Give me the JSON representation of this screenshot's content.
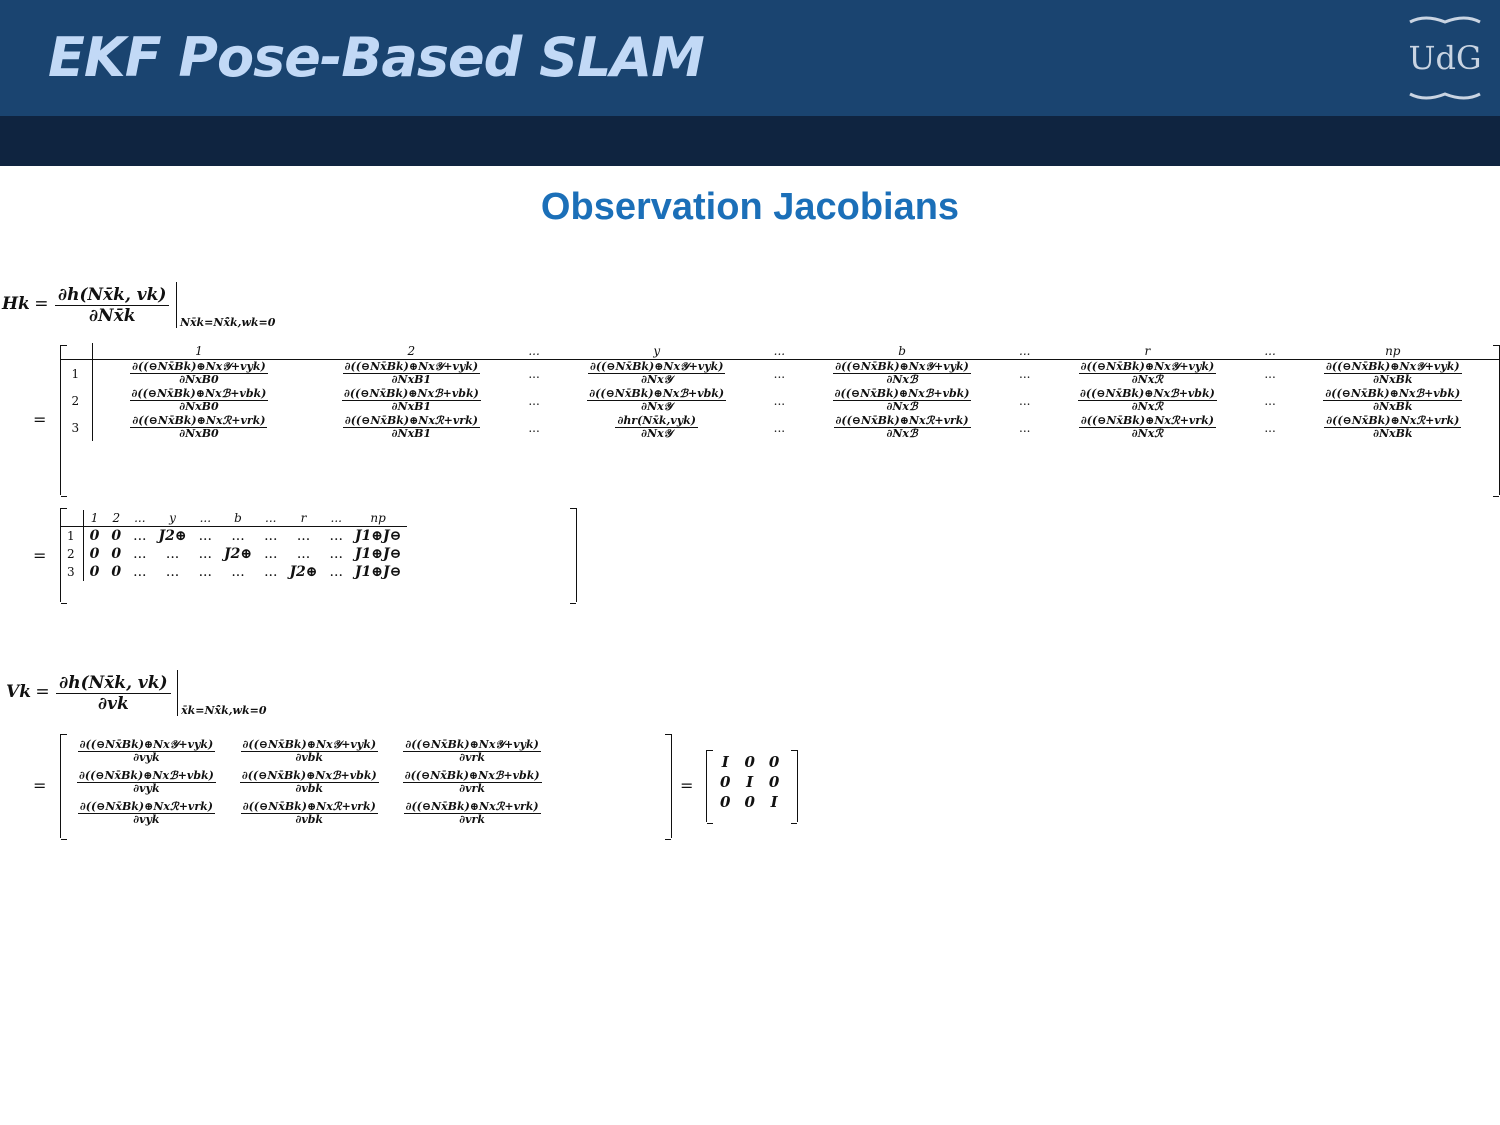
{
  "header": {
    "title": "EKF Pose-Based SLAM",
    "logo_text": "UdG"
  },
  "slide": {
    "subtitle": "Observation Jacobians"
  },
  "H": {
    "lhs": "Hk",
    "equals": "=",
    "num": "∂h(Nx̄k, vk)",
    "den": "∂Nx̄k",
    "eval": "Nx̄k=Nx̄̂k,wk=0",
    "cols": [
      "1",
      "2",
      "...",
      "y",
      "...",
      "b",
      "...",
      "r",
      "...",
      "np"
    ],
    "rows": [
      {
        "label": "1",
        "cells": [
          {
            "n": "∂((⊖Nx̄Bk)⊕Nx𝒴+vyk)",
            "d": "∂NxB0"
          },
          {
            "n": "∂((⊖Nx̄Bk)⊕Nx𝒴+vyk)",
            "d": "∂NxB1"
          },
          {
            "n": "...",
            "d": ""
          },
          {
            "n": "∂((⊖Nx̄Bk)⊕Nx𝒴+vyk)",
            "d": "∂Nx𝒴"
          },
          {
            "n": "...",
            "d": ""
          },
          {
            "n": "∂((⊖Nx̄Bk)⊕Nx𝒴+vyk)",
            "d": "∂Nxℬ"
          },
          {
            "n": "...",
            "d": ""
          },
          {
            "n": "∂((⊖Nx̄Bk)⊕Nx𝒴+vyk)",
            "d": "∂Nxℛ"
          },
          {
            "n": "...",
            "d": ""
          },
          {
            "n": "∂((⊖Nx̄Bk)⊕Nx𝒴+vyk)",
            "d": "∂NxBk"
          }
        ]
      },
      {
        "label": "2",
        "cells": [
          {
            "n": "∂((⊖Nx̄Bk)⊕Nxℬ+vbk)",
            "d": "∂NxB0"
          },
          {
            "n": "∂((⊖Nx̄Bk)⊕Nxℬ+vbk)",
            "d": "∂NxB1"
          },
          {
            "n": "...",
            "d": ""
          },
          {
            "n": "∂((⊖Nx̄Bk)⊕Nxℬ+vbk)",
            "d": "∂Nx𝒴"
          },
          {
            "n": "...",
            "d": ""
          },
          {
            "n": "∂((⊖Nx̄Bk)⊕Nxℬ+vbk)",
            "d": "∂Nxℬ"
          },
          {
            "n": "...",
            "d": ""
          },
          {
            "n": "∂((⊖Nx̄Bk)⊕Nxℬ+vbk)",
            "d": "∂Nxℛ"
          },
          {
            "n": "...",
            "d": ""
          },
          {
            "n": "∂((⊖Nx̄Bk)⊕Nxℬ+vbk)",
            "d": "∂NxBk"
          }
        ]
      },
      {
        "label": "3",
        "cells": [
          {
            "n": "∂((⊖Nx̄Bk)⊕Nxℛ+vrk)",
            "d": "∂NxB0"
          },
          {
            "n": "∂((⊖Nx̄Bk)⊕Nxℛ+vrk)",
            "d": "∂NxB1"
          },
          {
            "n": "...",
            "d": ""
          },
          {
            "n": "∂hr(Nx̄k,vyk)",
            "d": "∂Nx𝒴"
          },
          {
            "n": "...",
            "d": ""
          },
          {
            "n": "∂((⊖Nx̄Bk)⊕Nxℛ+vrk)",
            "d": "∂Nxℬ"
          },
          {
            "n": "...",
            "d": ""
          },
          {
            "n": "∂((⊖Nx̄Bk)⊕Nxℛ+vrk)",
            "d": "∂Nxℛ"
          },
          {
            "n": "...",
            "d": ""
          },
          {
            "n": "∂((⊖Nx̄Bk)⊕Nxℛ+vrk)",
            "d": "∂NxBk"
          }
        ]
      }
    ],
    "simple_cols": [
      "1",
      "2",
      "...",
      "y",
      "...",
      "b",
      "...",
      "r",
      "...",
      "np"
    ],
    "simple_rows": [
      {
        "label": "1",
        "cells": [
          "0",
          "0",
          "...",
          "J2⊕",
          "...",
          "...",
          "...",
          "...",
          "...",
          "J1⊕J⊖"
        ]
      },
      {
        "label": "2",
        "cells": [
          "0",
          "0",
          "...",
          "...",
          "...",
          "J2⊕",
          "...",
          "...",
          "...",
          "J1⊕J⊖"
        ]
      },
      {
        "label": "3",
        "cells": [
          "0",
          "0",
          "...",
          "...",
          "...",
          "...",
          "...",
          "J2⊕",
          "...",
          "J1⊕J⊖"
        ]
      }
    ]
  },
  "V": {
    "lhs": "Vk",
    "equals": "=",
    "num": "∂h(Nx̄k, vk)",
    "den": "∂vk",
    "eval": "x̄k=Nx̄̂k,wk=0",
    "rows": [
      [
        {
          "n": "∂((⊖Nx̄Bk)⊕Nx𝒴+vyk)",
          "d": "∂vyk"
        },
        {
          "n": "∂((⊖Nx̄Bk)⊕Nx𝒴+vyk)",
          "d": "∂vbk"
        },
        {
          "n": "∂((⊖Nx̄Bk)⊕Nx𝒴+vyk)",
          "d": "∂vrk"
        }
      ],
      [
        {
          "n": "∂((⊖Nx̄Bk)⊕Nxℬ+vbk)",
          "d": "∂vyk"
        },
        {
          "n": "∂((⊖Nx̄Bk)⊕Nxℬ+vbk)",
          "d": "∂vbk"
        },
        {
          "n": "∂((⊖Nx̄Bk)⊕Nxℬ+vbk)",
          "d": "∂vrk"
        }
      ],
      [
        {
          "n": "∂((⊖Nx̄Bk)⊕Nxℛ+vrk)",
          "d": "∂vyk"
        },
        {
          "n": "∂((⊖Nx̄Bk)⊕Nxℛ+vrk)",
          "d": "∂vbk"
        },
        {
          "n": "∂((⊖Nx̄Bk)⊕Nxℛ+vrk)",
          "d": "∂vrk"
        }
      ]
    ],
    "identity": [
      [
        "I",
        "0",
        "0"
      ],
      [
        "0",
        "I",
        "0"
      ],
      [
        "0",
        "0",
        "I"
      ]
    ]
  }
}
